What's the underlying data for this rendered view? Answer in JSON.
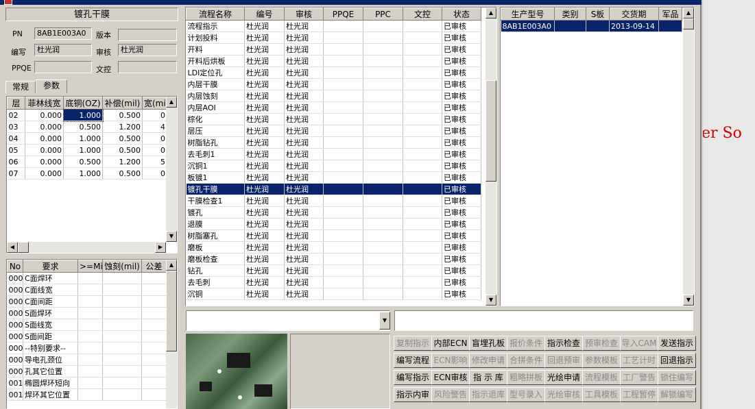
{
  "window": {
    "title": ""
  },
  "left_panel": {
    "title": "镀孔干膜",
    "fields": {
      "pn_label": "PN",
      "pn_value": "8AB1E003A0",
      "version_label": "版本",
      "version_value": "",
      "writer_label": "编写",
      "writer_value": "杜光润",
      "reviewer_label": "审核",
      "reviewer_value": "杜光润",
      "ppqe_label": "PPQE",
      "ppqe_value": "",
      "doc_control_label": "文控",
      "doc_control_value": ""
    },
    "tabs": [
      {
        "label": "常规"
      },
      {
        "label": "参数"
      }
    ],
    "param_table": {
      "headers": [
        "层",
        "菲林线宽",
        "底铜(OZ)",
        "补偿(mil)",
        "宽(mi"
      ],
      "rows": [
        [
          "02",
          "0.000",
          "1.000",
          "0.500",
          "0"
        ],
        [
          "03",
          "0.000",
          "0.500",
          "1.200",
          "4"
        ],
        [
          "04",
          "0.000",
          "1.000",
          "0.500",
          "0"
        ],
        [
          "05",
          "0.000",
          "1.000",
          "0.500",
          "0"
        ],
        [
          "06",
          "0.000",
          "0.500",
          "1.200",
          "5"
        ],
        [
          "07",
          "0.000",
          "1.000",
          "0.500",
          "0"
        ]
      ]
    },
    "req_table": {
      "headers": [
        "No",
        "要求",
        ">=Mil",
        "蚀刻(mil)",
        "公差"
      ],
      "rows": [
        [
          "000",
          "C面焊环"
        ],
        [
          "000",
          "C面线宽"
        ],
        [
          "000",
          "C面间距"
        ],
        [
          "000",
          "S面焊环"
        ],
        [
          "000",
          "S面线宽"
        ],
        [
          "000",
          "S面间距"
        ],
        [
          "000",
          "--特别要求--"
        ],
        [
          "000",
          "导电孔颈位"
        ],
        [
          "000",
          "孔其它位置"
        ],
        [
          "001",
          "椭圆焊环短向"
        ],
        [
          "001",
          "焊环其它位置"
        ]
      ]
    }
  },
  "process_table": {
    "headers": [
      "流程名称",
      "编号",
      "审核",
      "PPQE",
      "PPC",
      "文控",
      "状态"
    ],
    "rows": [
      [
        "流程指示",
        "杜光润",
        "杜光润",
        "",
        "",
        "",
        "已审核"
      ],
      [
        "计划投料",
        "杜光润",
        "杜光润",
        "",
        "",
        "",
        "已审核"
      ],
      [
        "开料",
        "杜光润",
        "杜光润",
        "",
        "",
        "",
        "已审核"
      ],
      [
        "开料后烘板",
        "杜光润",
        "杜光润",
        "",
        "",
        "",
        "已审核"
      ],
      [
        "LDI定位孔",
        "杜光润",
        "杜光润",
        "",
        "",
        "",
        "已审核"
      ],
      [
        "内层干膜",
        "杜光润",
        "杜光润",
        "",
        "",
        "",
        "已审核"
      ],
      [
        "内层蚀刻",
        "杜光润",
        "杜光润",
        "",
        "",
        "",
        "已审核"
      ],
      [
        "内层AOI",
        "杜光润",
        "杜光润",
        "",
        "",
        "",
        "已审核"
      ],
      [
        "棕化",
        "杜光润",
        "杜光润",
        "",
        "",
        "",
        "已审核"
      ],
      [
        "层压",
        "杜光润",
        "杜光润",
        "",
        "",
        "",
        "已审核"
      ],
      [
        "树脂钻孔",
        "杜光润",
        "杜光润",
        "",
        "",
        "",
        "已审核"
      ],
      [
        "去毛刺1",
        "杜光润",
        "杜光润",
        "",
        "",
        "",
        "已审核"
      ],
      [
        "沉铜1",
        "杜光润",
        "杜光润",
        "",
        "",
        "",
        "已审核"
      ],
      [
        "板镀1",
        "杜光润",
        "杜光润",
        "",
        "",
        "",
        "已审核"
      ],
      [
        "镀孔干膜",
        "杜光润",
        "杜光润",
        "",
        "",
        "",
        "已审核"
      ],
      [
        "干膜检查1",
        "杜光润",
        "杜光润",
        "",
        "",
        "",
        "已审核"
      ],
      [
        "镀孔",
        "杜光润",
        "杜光润",
        "",
        "",
        "",
        "已审核"
      ],
      [
        "退膜",
        "杜光润",
        "杜光润",
        "",
        "",
        "",
        "已审核"
      ],
      [
        "树脂塞孔",
        "杜光润",
        "杜光润",
        "",
        "",
        "",
        "已审核"
      ],
      [
        "磨板",
        "杜光润",
        "杜光润",
        "",
        "",
        "",
        "已审核"
      ],
      [
        "磨板检查",
        "杜光润",
        "杜光润",
        "",
        "",
        "",
        "已审核"
      ],
      [
        "钻孔",
        "杜光润",
        "杜光润",
        "",
        "",
        "",
        "已审核"
      ],
      [
        "去毛刺",
        "杜光润",
        "杜光润",
        "",
        "",
        "",
        "已审核"
      ],
      [
        "沉铜",
        "杜光润",
        "杜光润",
        "",
        "",
        "",
        "已审核"
      ]
    ]
  },
  "product_table": {
    "headers": [
      "生产型号",
      "类别",
      "S板",
      "交货期",
      "军品"
    ],
    "rows": [
      [
        "8AB1E003A0",
        "",
        "",
        "2013-09-14",
        ""
      ]
    ]
  },
  "buttons": [
    [
      "复制指示",
      "内部ECN",
      "盲埋孔板",
      "报价条件",
      "指示检查",
      "预审检查",
      "导入CAM",
      "发送指示"
    ],
    [
      "编写流程",
      "ECN影响",
      "修改申请",
      "合拼条件",
      "回退预审",
      "参数模板",
      "工艺计时",
      "回退指示"
    ],
    [
      "编写指示",
      "ECN审核",
      "指 示 库",
      "粗略拼板",
      "光绘申请",
      "流程模板",
      "工厂警告",
      "锁住编写"
    ],
    [
      "指示内审",
      "风险警告",
      "指示退库",
      "型号录入",
      "光绘审核",
      "工具模板",
      "工程暂停",
      "解锁编写"
    ]
  ],
  "buttons_disabled": [
    [
      true,
      false,
      false,
      true,
      false,
      true,
      true,
      false
    ],
    [
      false,
      true,
      true,
      true,
      true,
      true,
      true,
      false
    ],
    [
      false,
      false,
      false,
      true,
      false,
      true,
      true,
      true
    ],
    [
      false,
      true,
      true,
      true,
      true,
      true,
      true,
      true
    ]
  ],
  "desktop_text": "er So"
}
